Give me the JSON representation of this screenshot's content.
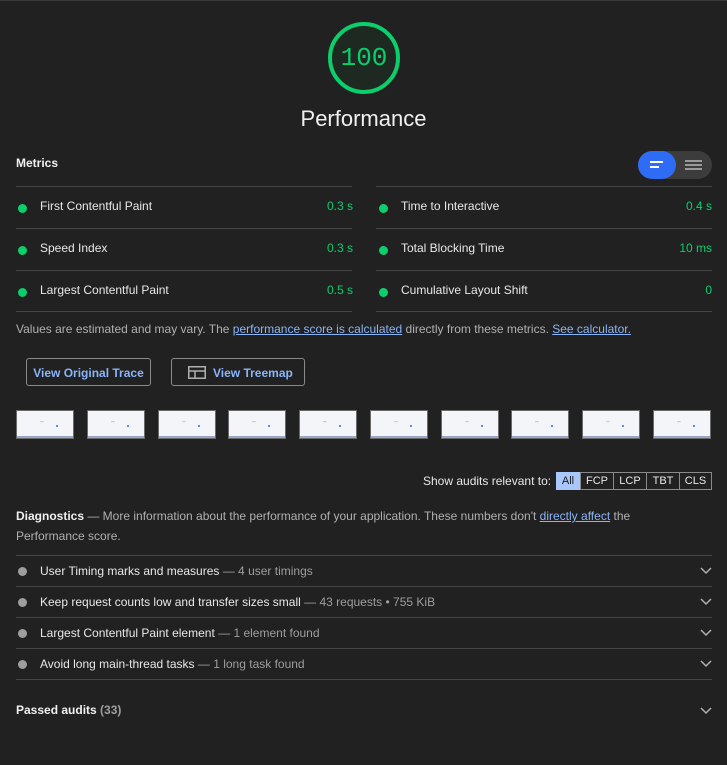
{
  "gauge": {
    "score": "100",
    "title": "Performance",
    "color": "#0cce6b"
  },
  "metrics": {
    "label": "Metrics",
    "left": [
      {
        "name": "First Contentful Paint",
        "value": "0.3 s"
      },
      {
        "name": "Speed Index",
        "value": "0.3 s"
      },
      {
        "name": "Largest Contentful Paint",
        "value": "0.5 s"
      }
    ],
    "right": [
      {
        "name": "Time to Interactive",
        "value": "0.4 s"
      },
      {
        "name": "Total Blocking Time",
        "value": "10 ms"
      },
      {
        "name": "Cumulative Layout Shift",
        "value": "0"
      }
    ],
    "status_color": "#0cce6b"
  },
  "note": {
    "before": "Values are estimated and may vary. The ",
    "link1": "performance score is calculated",
    "middle": " directly from these metrics. ",
    "link2": "See calculator."
  },
  "buttons": {
    "trace": "View Original Trace",
    "treemap": "View Treemap"
  },
  "filmstrip": {
    "frame_text": "\"\""
  },
  "filter": {
    "label": "Show audits relevant to:",
    "options": [
      "All",
      "FCP",
      "LCP",
      "TBT",
      "CLS"
    ],
    "active": "All"
  },
  "diagnostics": {
    "title": "Diagnostics",
    "desc_before": " — More information about the performance of your application. These numbers don't ",
    "link": "directly affect",
    "desc_after": " the Performance score.",
    "items": [
      {
        "name": "User Timing marks and measures",
        "detail": " — 4 user timings"
      },
      {
        "name": "Keep request counts low and transfer sizes small",
        "detail": " — 43 requests • 755 KiB"
      },
      {
        "name": "Largest Contentful Paint element",
        "detail": " — 1 element found"
      },
      {
        "name": "Avoid long main-thread tasks",
        "detail": " — 1 long task found"
      }
    ]
  },
  "passed": {
    "label": "Passed audits",
    "count": "(33)"
  }
}
